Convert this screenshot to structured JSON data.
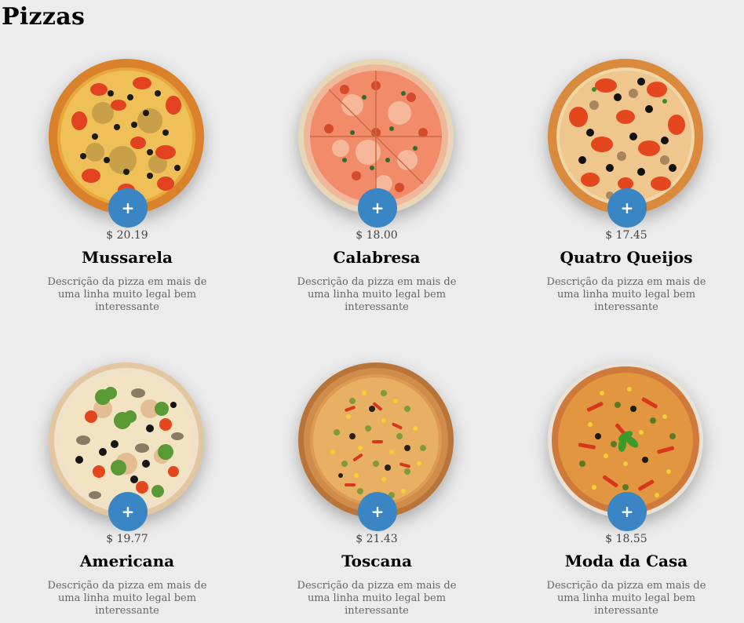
{
  "page": {
    "title": "Pizzas"
  },
  "colors": {
    "add_button": "#3a86c4",
    "background": "#ececec"
  },
  "pizzas": [
    {
      "name": "Mussarela",
      "price": "$ 20.19",
      "description": "Descrição da pizza em mais de uma linha muito legal bem interessante",
      "add_label": "+",
      "image": "mussarela-pizza"
    },
    {
      "name": "Calabresa",
      "price": "$ 18.00",
      "description": "Descrição da pizza em mais de uma linha muito legal bem interessante",
      "add_label": "+",
      "image": "calabresa-pizza"
    },
    {
      "name": "Quatro Queijos",
      "price": "$ 17.45",
      "description": "Descrição da pizza em mais de uma linha muito legal bem interessante",
      "add_label": "+",
      "image": "quatro-queijos-pizza"
    },
    {
      "name": "Americana",
      "price": "$ 19.77",
      "description": "Descrição da pizza em mais de uma linha muito legal bem interessante",
      "add_label": "+",
      "image": "americana-pizza"
    },
    {
      "name": "Toscana",
      "price": "$ 21.43",
      "description": "Descrição da pizza em mais de uma linha muito legal bem interessante",
      "add_label": "+",
      "image": "toscana-pizza"
    },
    {
      "name": "Moda da Casa",
      "price": "$ 18.55",
      "description": "Descrição da pizza em mais de uma linha muito legal bem interessante",
      "add_label": "+",
      "image": "moda-da-casa-pizza"
    }
  ]
}
